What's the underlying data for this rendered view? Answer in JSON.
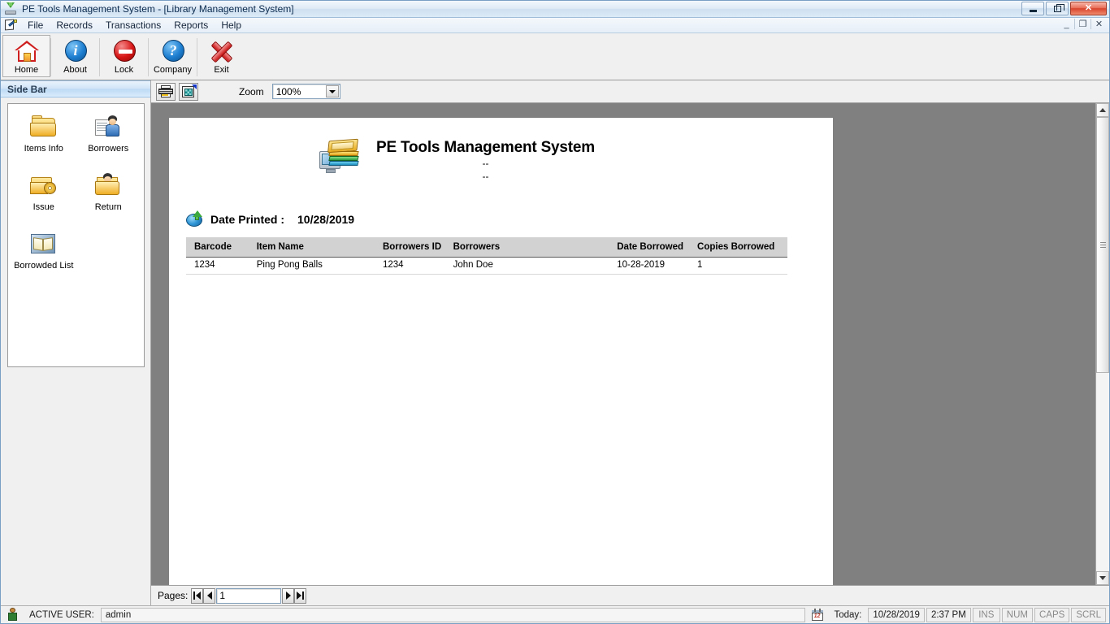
{
  "window": {
    "title": "PE Tools Management System - [Library Management System]",
    "app_icon": "download-tray-icon",
    "controls": {
      "minimize": "–",
      "maximize": "❐",
      "close": "✕"
    },
    "mdi_controls": {
      "minimize": "_",
      "restore": "❐",
      "close": "✕"
    }
  },
  "menubar": {
    "icon": "mdi-document-pen-icon",
    "items": [
      {
        "label": "File"
      },
      {
        "label": "Records"
      },
      {
        "label": "Transactions"
      },
      {
        "label": "Reports"
      },
      {
        "label": "Help"
      }
    ]
  },
  "toolbar": {
    "buttons": [
      {
        "label": "Home",
        "icon": "home-icon"
      },
      {
        "label": "About",
        "icon": "info-circle-icon",
        "glyph": "i"
      },
      {
        "label": "Lock",
        "icon": "no-entry-icon"
      },
      {
        "label": "Company",
        "icon": "question-circle-icon",
        "glyph": "?"
      },
      {
        "label": "Exit",
        "icon": "red-x-icon"
      }
    ]
  },
  "sidebar": {
    "header": "Side Bar",
    "items": [
      {
        "label": "Items Info",
        "icon": "folder-icon"
      },
      {
        "label": "Borrowers",
        "icon": "person-list-icon"
      },
      {
        "label": "Issue",
        "icon": "folder-disc-icon"
      },
      {
        "label": "Return",
        "icon": "folder-person-icon"
      },
      {
        "label": "Borrowded List",
        "icon": "open-book-icon"
      }
    ]
  },
  "report_toolbar": {
    "print_button": "print-icon",
    "export_button": "export-icon",
    "zoom_label": "Zoom",
    "zoom_value": "100%",
    "zoom_options": [
      "100%"
    ]
  },
  "report": {
    "logo": "computer-books-icon",
    "title": "PE Tools Management System",
    "subtitle_line1": "--",
    "subtitle_line2": "--",
    "date_icon": "globe-upload-icon",
    "date_label": "Date Printed :",
    "date_value": "10/28/2019",
    "columns": [
      "Barcode",
      "Item Name",
      "Borrowers ID",
      "Borrowers",
      "Date Borrowed",
      "Copies Borrowed"
    ],
    "rows": [
      {
        "barcode": "1234",
        "item_name": "Ping Pong Balls",
        "borrowers_id": "1234",
        "borrowers": "John Doe",
        "date_borrowed": "10-28-2019",
        "copies_borrowed": "1"
      }
    ]
  },
  "pages_bar": {
    "label": "Pages:",
    "first_button": "first-page-icon",
    "prev_button": "previous-page-icon",
    "page_value": "1",
    "next_button": "next-page-icon",
    "last_button": "last-page-icon"
  },
  "statusbar": {
    "user_icon": "user-icon",
    "user_label": "ACTIVE USER:",
    "user_value": "admin",
    "calendar_icon": "calendar-icon",
    "today_label": "Today:",
    "today_date": "10/28/2019",
    "today_time": "2:37 PM",
    "indicators": [
      "INS",
      "NUM",
      "CAPS",
      "SCRL"
    ]
  },
  "colors": {
    "titlebar_accent": "#cfe0f0",
    "sidebar_header": "#bcd9f4",
    "report_background": "#808080",
    "page": "#ffffff",
    "table_header": "#d2d2d2",
    "close_button": "#d8442c"
  }
}
